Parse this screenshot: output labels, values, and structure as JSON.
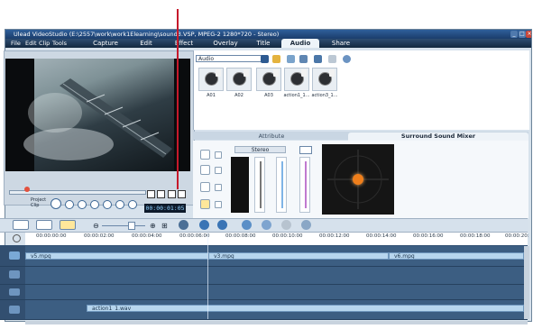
{
  "window": {
    "title": "Ulead VideoStudio (E:\\2557\\work\\work1Elearning\\sound3.VSP, MPEG-2 1280*720 - Stereo)"
  },
  "menu": {
    "items": [
      "File",
      "Edit",
      "Clip",
      "Tools"
    ],
    "tabs": [
      "Capture",
      "Edit",
      "Effect",
      "Overlay",
      "Title",
      "Audio",
      "Share"
    ],
    "active_tab": "Audio"
  },
  "library": {
    "category": "Audio",
    "clips": [
      "A01",
      "A02",
      "A03",
      "action1_1...",
      "action3_1..."
    ]
  },
  "options_panel": {
    "tabs": [
      "Attribute",
      "Surround Sound Mixer"
    ],
    "active_tab": "Surround Sound Mixer",
    "channel_mode": "Stereo"
  },
  "preview": {
    "mode_labels": [
      "Project",
      "Clip"
    ],
    "timecode": "00:00:01:05"
  },
  "timeline": {
    "ruler_ticks": [
      "00:00:00:00",
      "00:00:02:00",
      "00:00:04:00",
      "00:00:06:00",
      "00:00:08:00",
      "00:00:10:00",
      "00:00:12:00",
      "00:00:14:00",
      "00:00:16:00",
      "00:00:18:00",
      "00:00:20:"
    ],
    "video_clips": [
      "v5.mpg",
      "v3.mpg",
      "v6.mpg"
    ],
    "audio_clip": "action1_1.wav"
  },
  "colors": {
    "annotation": "#c6192b",
    "menubar": "#1b3250",
    "track_bg": "#2f4f72",
    "clip": "#b7d6ee"
  }
}
